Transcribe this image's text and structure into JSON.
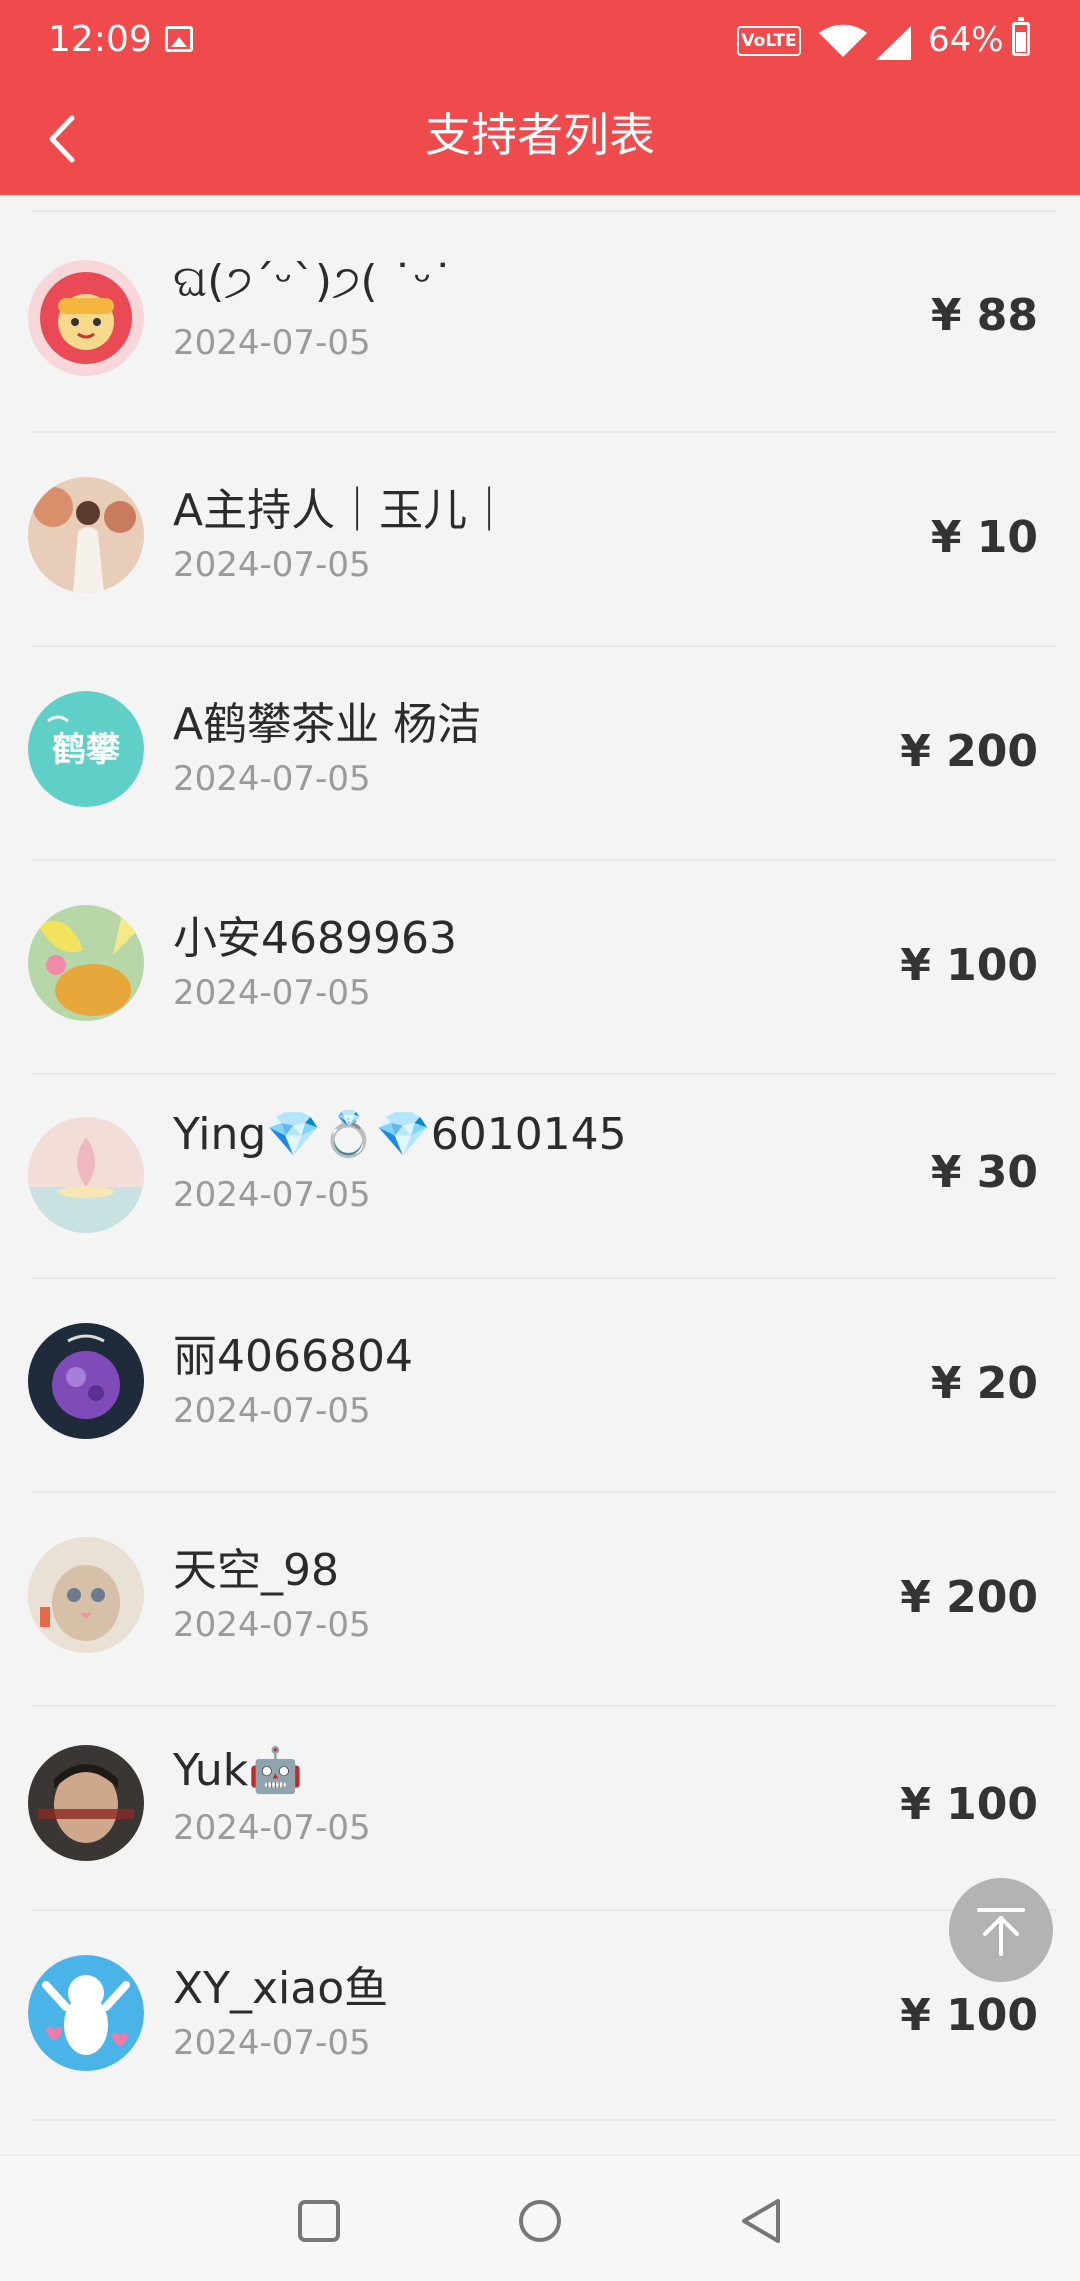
{
  "status_bar": {
    "time": "12:09",
    "network_badge": "VoLTE",
    "battery": "64%",
    "icons": [
      "gallery-icon",
      "wifi-icon",
      "signal-icon",
      "battery-icon"
    ]
  },
  "header": {
    "title": "支持者列表",
    "back_icon": "chevron-left-icon"
  },
  "supporters": [
    {
      "name": "ଘ(੭ˊᵕˋ)੭( ˙ᵕ˙ ",
      "date": "2024-07-05",
      "amount": "¥ 88"
    },
    {
      "name": "A主持人｜玉儿｜",
      "date": "2024-07-05",
      "amount": "¥ 10"
    },
    {
      "name": "A鹤攀茶业 杨洁",
      "date": "2024-07-05",
      "amount": "¥ 200"
    },
    {
      "name": "小安4689963",
      "date": "2024-07-05",
      "amount": "¥ 100"
    },
    {
      "name": "Ying💎💍💎6010145",
      "date": "2024-07-05",
      "amount": "¥ 30"
    },
    {
      "name": "丽4066804",
      "date": "2024-07-05",
      "amount": "¥ 20"
    },
    {
      "name": "天空_98",
      "date": "2024-07-05",
      "amount": "¥ 200"
    },
    {
      "name": "Yuk🤖",
      "date": "2024-07-05",
      "amount": "¥ 100"
    },
    {
      "name": "XY_xiao鱼",
      "date": "2024-07-05",
      "amount": "¥ 100"
    }
  ],
  "avatar_logo_text": "鹤攀",
  "scroll_top_icon": "arrow-up-to-top-icon",
  "nav": {
    "icons": [
      "recent-apps-icon",
      "home-icon",
      "back-icon"
    ]
  },
  "colors": {
    "header": "#ef4b4c",
    "background": "#f4f4f4",
    "amount": "#333333",
    "date": "#9a9a9a"
  }
}
